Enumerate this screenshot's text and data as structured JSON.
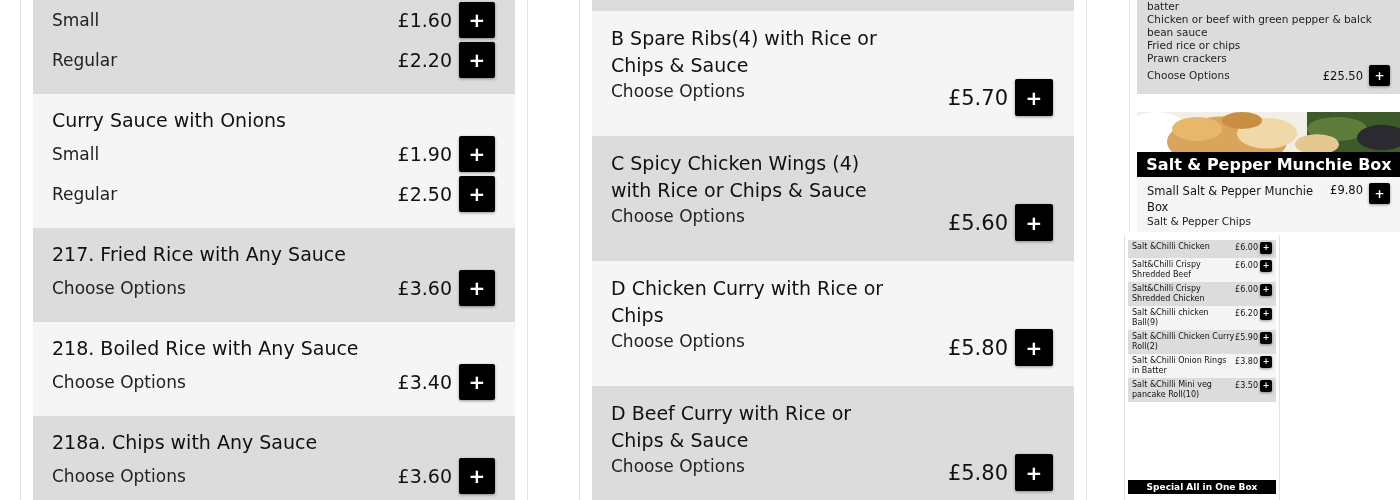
{
  "left_column": {
    "items": [
      {
        "lines": [
          {
            "label": "Small",
            "price": "£1.60"
          },
          {
            "label": "Regular",
            "price": "£2.20"
          }
        ]
      },
      {
        "title": "Curry Sauce with Onions",
        "lines": [
          {
            "label": "Small",
            "price": "£1.90"
          },
          {
            "label": "Regular",
            "price": "£2.50"
          }
        ]
      },
      {
        "title": "217. Fried Rice with Any Sauce",
        "lines": [
          {
            "label": "Choose Options",
            "price": "£3.60"
          }
        ]
      },
      {
        "title": "218. Boiled Rice with Any Sauce",
        "lines": [
          {
            "label": "Choose Options",
            "price": "£3.40"
          }
        ]
      },
      {
        "title": "218a. Chips with Any Sauce",
        "lines": [
          {
            "label": "Choose Options",
            "price": "£3.60"
          }
        ]
      }
    ]
  },
  "middle_column": {
    "items": [
      {
        "title": "B Spare Ribs(4) with Rice or Chips & Sauce",
        "lines": [
          {
            "label": "Choose Options",
            "price": "£5.70"
          }
        ]
      },
      {
        "title": "C Spicy Chicken Wings (4) with Rice or Chips & Sauce",
        "lines": [
          {
            "label": "Choose Options",
            "price": "£5.60"
          }
        ]
      },
      {
        "title": "D Chicken Curry with Rice or Chips",
        "lines": [
          {
            "label": "Choose Options",
            "price": "£5.80"
          }
        ]
      },
      {
        "title": "D Beef Curry with Rice or Chips & Sauce",
        "lines": [
          {
            "label": "Choose Options",
            "price": "£5.80"
          }
        ]
      }
    ]
  },
  "right_column": {
    "set_meal": {
      "description": [
        "batter",
        "Chicken or beef with green pepper & balck bean sauce",
        "Fried rice or chips",
        "Prawn crackers"
      ],
      "options": "Choose Options",
      "price": "£25.50"
    },
    "section": {
      "title": "Salt & Pepper Munchie Box",
      "items": [
        {
          "title": "Small Salt & Pepper Munchie Box",
          "price": "£9.80",
          "description": "Salt & Pepper Chips"
        }
      ]
    }
  },
  "mini_panel": {
    "items": [
      {
        "name": "Salt &Chilli Chicken",
        "price": "£6.00"
      },
      {
        "name": "Salt&Chilli Crispy Shredded Beef",
        "price": "£6.00"
      },
      {
        "name": "Salt&Chilli Crispy Shredded Chicken",
        "price": "£6.00"
      },
      {
        "name": "Salt &Chilli chicken Ball(9)",
        "price": "£6.20"
      },
      {
        "name": "Salt &Chilli Chicken Curry Roll(2)",
        "price": "£5.90"
      },
      {
        "name": "Salt &Chilli Onion Rings in Batter",
        "price": "£3.80"
      },
      {
        "name": "Salt &Chilli Mini veg pancake Roll(10)",
        "price": "£3.50"
      }
    ],
    "banner": "Special All in One Box"
  },
  "add_button_label": "+"
}
